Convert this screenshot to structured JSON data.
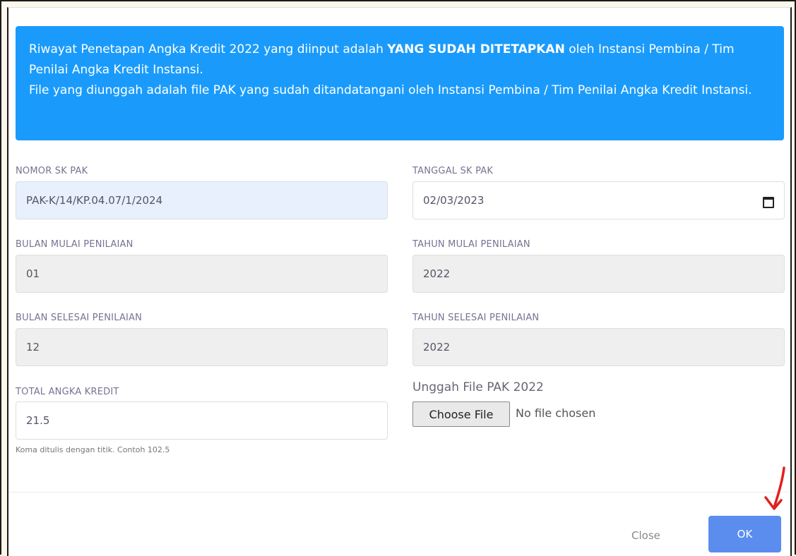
{
  "alert": {
    "text_part1": "Riwayat Penetapan Angka Kredit 2022 yang diinput adalah ",
    "text_bold": "YANG SUDAH DITETAPKAN",
    "text_part2": " oleh Instansi Pembina / Tim Penilai Angka Kredit Instansi.",
    "text_line2": "File yang diunggah adalah file PAK yang sudah ditandatangani oleh Instansi Pembina / Tim Penilai Angka Kredit Instansi.",
    "bg_color": "#1a9bfc"
  },
  "form": {
    "nomor_sk_pak": {
      "label": "NOMOR SK PAK",
      "value": "PAK-K/14/KP.04.07/1/2024"
    },
    "tanggal_sk_pak": {
      "label": "TANGGAL SK PAK",
      "value": "02/03/2023",
      "icon": "calendar-icon"
    },
    "bulan_mulai": {
      "label": "BULAN MULAI PENILAIAN",
      "value": "01"
    },
    "tahun_mulai": {
      "label": "TAHUN MULAI PENILAIAN",
      "value": "2022"
    },
    "bulan_selesai": {
      "label": "BULAN SELESAI PENILAIAN",
      "value": "12"
    },
    "tahun_selesai": {
      "label": "TAHUN SELESAI PENILAIAN",
      "value": "2022"
    },
    "total_angka_kredit": {
      "label": "TOTAL ANGKA KREDIT",
      "value": "21.5",
      "hint": "Koma ditulis dengan titik. Contoh 102.5"
    },
    "upload": {
      "label": "Unggah File PAK 2022",
      "button": "Choose File",
      "status": "No file chosen"
    }
  },
  "footer": {
    "close_label": "Close",
    "ok_label": "OK",
    "ok_color": "#5b8def",
    "annotation_icon": "red-arrow-icon"
  }
}
